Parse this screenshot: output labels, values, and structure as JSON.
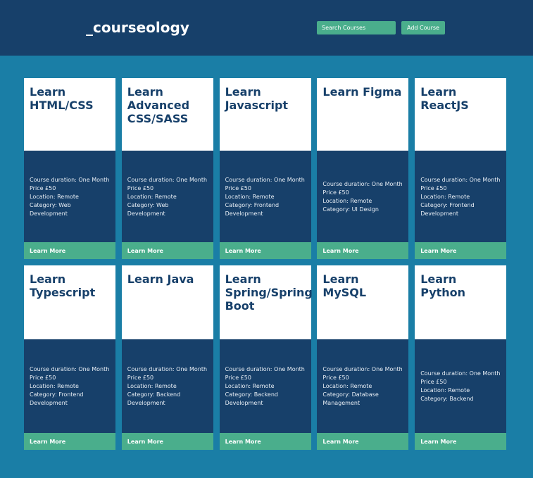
{
  "header": {
    "logo": "_courseology",
    "search_placeholder": "Search Courses",
    "add_label": "Add Course"
  },
  "colors": {
    "header_bg": "#17406a",
    "page_bg": "#1a7ea6",
    "accent": "#4aae8c",
    "card_top_bg": "#ffffff",
    "card_body_bg": "#17406a"
  },
  "courses": [
    {
      "title": "Learn HTML/CSS",
      "duration": "Course duration: One Month",
      "price": "Price £50",
      "location": "Location: Remote",
      "category": "Category: Web Development",
      "button": "Learn More"
    },
    {
      "title": "Learn Advanced CSS/SASS",
      "duration": "Course duration: One Month",
      "price": "Price £50",
      "location": "Location: Remote",
      "category": "Category: Web Development",
      "button": "Learn More"
    },
    {
      "title": "Learn Javascript",
      "duration": "Course duration: One Month",
      "price": "Price £50",
      "location": "Location: Remote",
      "category": "Category: Frontend Development",
      "button": "Learn More"
    },
    {
      "title": "Learn Figma",
      "duration": "Course duration: One Month",
      "price": "Price £50",
      "location": "Location: Remote",
      "category": "Category: UI Design",
      "button": "Learn More"
    },
    {
      "title": "Learn ReactJS",
      "duration": "Course duration: One Month",
      "price": "Price £50",
      "location": "Location: Remote",
      "category": "Category: Frontend Development",
      "button": "Learn More"
    },
    {
      "title": "Learn Typescript",
      "duration": "Course duration: One Month",
      "price": "Price £50",
      "location": "Location: Remote",
      "category": "Category: Frontend Development",
      "button": "Learn More"
    },
    {
      "title": "Learn Java",
      "duration": "Course duration: One Month",
      "price": "Price £50",
      "location": "Location: Remote",
      "category": "Category: Backend Development",
      "button": "Learn More"
    },
    {
      "title": "Learn Spring/Spring Boot",
      "duration": "Course duration: One Month",
      "price": "Price £50",
      "location": "Location: Remote",
      "category": "Category: Backend Development",
      "button": "Learn More"
    },
    {
      "title": "Learn MySQL",
      "duration": "Course duration: One Month",
      "price": "Price £50",
      "location": "Location: Remote",
      "category": "Category: Database Management",
      "button": "Learn More"
    },
    {
      "title": "Learn Python",
      "duration": "Course duration: One Month",
      "price": "Price £50",
      "location": "Location: Remote",
      "category": "Category: Backend",
      "button": "Learn More"
    }
  ]
}
